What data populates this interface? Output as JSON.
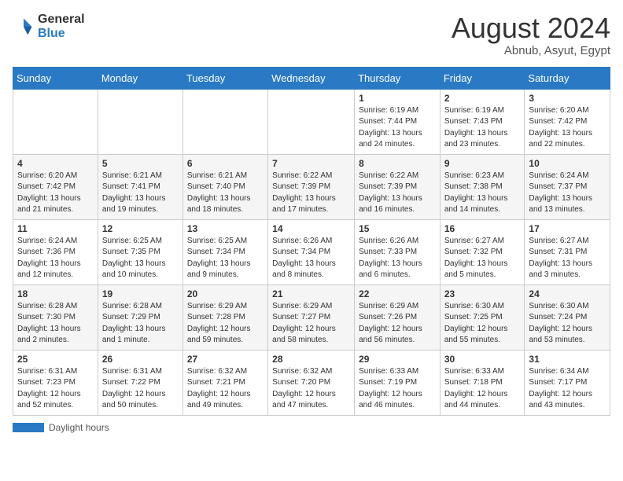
{
  "logo": {
    "general": "General",
    "blue": "Blue"
  },
  "title": {
    "month_year": "August 2024",
    "location": "Abnub, Asyut, Egypt"
  },
  "days_of_week": [
    "Sunday",
    "Monday",
    "Tuesday",
    "Wednesday",
    "Thursday",
    "Friday",
    "Saturday"
  ],
  "weeks": [
    [
      {
        "day": "",
        "info": ""
      },
      {
        "day": "",
        "info": ""
      },
      {
        "day": "",
        "info": ""
      },
      {
        "day": "",
        "info": ""
      },
      {
        "day": "1",
        "info": "Sunrise: 6:19 AM\nSunset: 7:44 PM\nDaylight: 13 hours and 24 minutes."
      },
      {
        "day": "2",
        "info": "Sunrise: 6:19 AM\nSunset: 7:43 PM\nDaylight: 13 hours and 23 minutes."
      },
      {
        "day": "3",
        "info": "Sunrise: 6:20 AM\nSunset: 7:42 PM\nDaylight: 13 hours and 22 minutes."
      }
    ],
    [
      {
        "day": "4",
        "info": "Sunrise: 6:20 AM\nSunset: 7:42 PM\nDaylight: 13 hours and 21 minutes."
      },
      {
        "day": "5",
        "info": "Sunrise: 6:21 AM\nSunset: 7:41 PM\nDaylight: 13 hours and 19 minutes."
      },
      {
        "day": "6",
        "info": "Sunrise: 6:21 AM\nSunset: 7:40 PM\nDaylight: 13 hours and 18 minutes."
      },
      {
        "day": "7",
        "info": "Sunrise: 6:22 AM\nSunset: 7:39 PM\nDaylight: 13 hours and 17 minutes."
      },
      {
        "day": "8",
        "info": "Sunrise: 6:22 AM\nSunset: 7:39 PM\nDaylight: 13 hours and 16 minutes."
      },
      {
        "day": "9",
        "info": "Sunrise: 6:23 AM\nSunset: 7:38 PM\nDaylight: 13 hours and 14 minutes."
      },
      {
        "day": "10",
        "info": "Sunrise: 6:24 AM\nSunset: 7:37 PM\nDaylight: 13 hours and 13 minutes."
      }
    ],
    [
      {
        "day": "11",
        "info": "Sunrise: 6:24 AM\nSunset: 7:36 PM\nDaylight: 13 hours and 12 minutes."
      },
      {
        "day": "12",
        "info": "Sunrise: 6:25 AM\nSunset: 7:35 PM\nDaylight: 13 hours and 10 minutes."
      },
      {
        "day": "13",
        "info": "Sunrise: 6:25 AM\nSunset: 7:34 PM\nDaylight: 13 hours and 9 minutes."
      },
      {
        "day": "14",
        "info": "Sunrise: 6:26 AM\nSunset: 7:34 PM\nDaylight: 13 hours and 8 minutes."
      },
      {
        "day": "15",
        "info": "Sunrise: 6:26 AM\nSunset: 7:33 PM\nDaylight: 13 hours and 6 minutes."
      },
      {
        "day": "16",
        "info": "Sunrise: 6:27 AM\nSunset: 7:32 PM\nDaylight: 13 hours and 5 minutes."
      },
      {
        "day": "17",
        "info": "Sunrise: 6:27 AM\nSunset: 7:31 PM\nDaylight: 13 hours and 3 minutes."
      }
    ],
    [
      {
        "day": "18",
        "info": "Sunrise: 6:28 AM\nSunset: 7:30 PM\nDaylight: 13 hours and 2 minutes."
      },
      {
        "day": "19",
        "info": "Sunrise: 6:28 AM\nSunset: 7:29 PM\nDaylight: 13 hours and 1 minute."
      },
      {
        "day": "20",
        "info": "Sunrise: 6:29 AM\nSunset: 7:28 PM\nDaylight: 12 hours and 59 minutes."
      },
      {
        "day": "21",
        "info": "Sunrise: 6:29 AM\nSunset: 7:27 PM\nDaylight: 12 hours and 58 minutes."
      },
      {
        "day": "22",
        "info": "Sunrise: 6:29 AM\nSunset: 7:26 PM\nDaylight: 12 hours and 56 minutes."
      },
      {
        "day": "23",
        "info": "Sunrise: 6:30 AM\nSunset: 7:25 PM\nDaylight: 12 hours and 55 minutes."
      },
      {
        "day": "24",
        "info": "Sunrise: 6:30 AM\nSunset: 7:24 PM\nDaylight: 12 hours and 53 minutes."
      }
    ],
    [
      {
        "day": "25",
        "info": "Sunrise: 6:31 AM\nSunset: 7:23 PM\nDaylight: 12 hours and 52 minutes."
      },
      {
        "day": "26",
        "info": "Sunrise: 6:31 AM\nSunset: 7:22 PM\nDaylight: 12 hours and 50 minutes."
      },
      {
        "day": "27",
        "info": "Sunrise: 6:32 AM\nSunset: 7:21 PM\nDaylight: 12 hours and 49 minutes."
      },
      {
        "day": "28",
        "info": "Sunrise: 6:32 AM\nSunset: 7:20 PM\nDaylight: 12 hours and 47 minutes."
      },
      {
        "day": "29",
        "info": "Sunrise: 6:33 AM\nSunset: 7:19 PM\nDaylight: 12 hours and 46 minutes."
      },
      {
        "day": "30",
        "info": "Sunrise: 6:33 AM\nSunset: 7:18 PM\nDaylight: 12 hours and 44 minutes."
      },
      {
        "day": "31",
        "info": "Sunrise: 6:34 AM\nSunset: 7:17 PM\nDaylight: 12 hours and 43 minutes."
      }
    ]
  ],
  "footer": {
    "label": "Daylight hours"
  }
}
